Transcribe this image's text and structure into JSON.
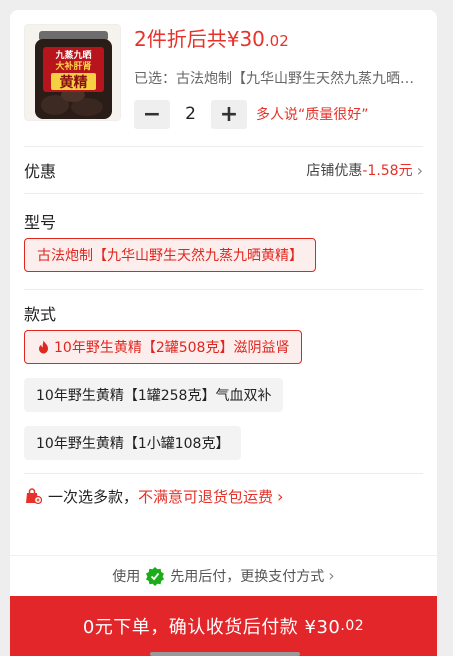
{
  "product": {
    "thumb_lines": [
      "九蒸九晒",
      "大补肝肾",
      "黄精"
    ],
    "price_prefix": "2件折后共¥30",
    "price_cents": ".02",
    "selected_text": "已选：古法炮制【九华山野生天然九蒸九晒黄精】",
    "quantity": "2",
    "minus_label": "−",
    "plus_label": "+",
    "praise": "多人说“质量很好”"
  },
  "discount": {
    "title": "优惠",
    "label": "店铺优惠",
    "amount": "-1.58元",
    "chevron": "›"
  },
  "type_section": {
    "title": "型号",
    "options": [
      {
        "label": "古法炮制【九华山野生天然九蒸九晒黄精】",
        "selected": true
      }
    ]
  },
  "style_section": {
    "title": "款式",
    "options": [
      {
        "label": "10年野生黄精【2罐508克】滋阴益肾",
        "selected": true,
        "hot": true
      },
      {
        "label": "10年野生黄精【1罐258克】气血双补",
        "selected": false
      },
      {
        "label": "10年野生黄精【1小罐108克】",
        "selected": false
      }
    ]
  },
  "policy": {
    "prefix": "一次选多款，",
    "highlight": "不满意可退货包运费",
    "chevron": "›"
  },
  "payment": {
    "prefix": "使用",
    "method": "先用后付，更换支付方式",
    "chevron": "›"
  },
  "cta": {
    "text": "0元下单，确认收货后付款 ¥30",
    "cents": ".02"
  },
  "colors": {
    "accent": "#e2262a",
    "price_red": "#e6322a",
    "pay_green": "#1aad19"
  }
}
